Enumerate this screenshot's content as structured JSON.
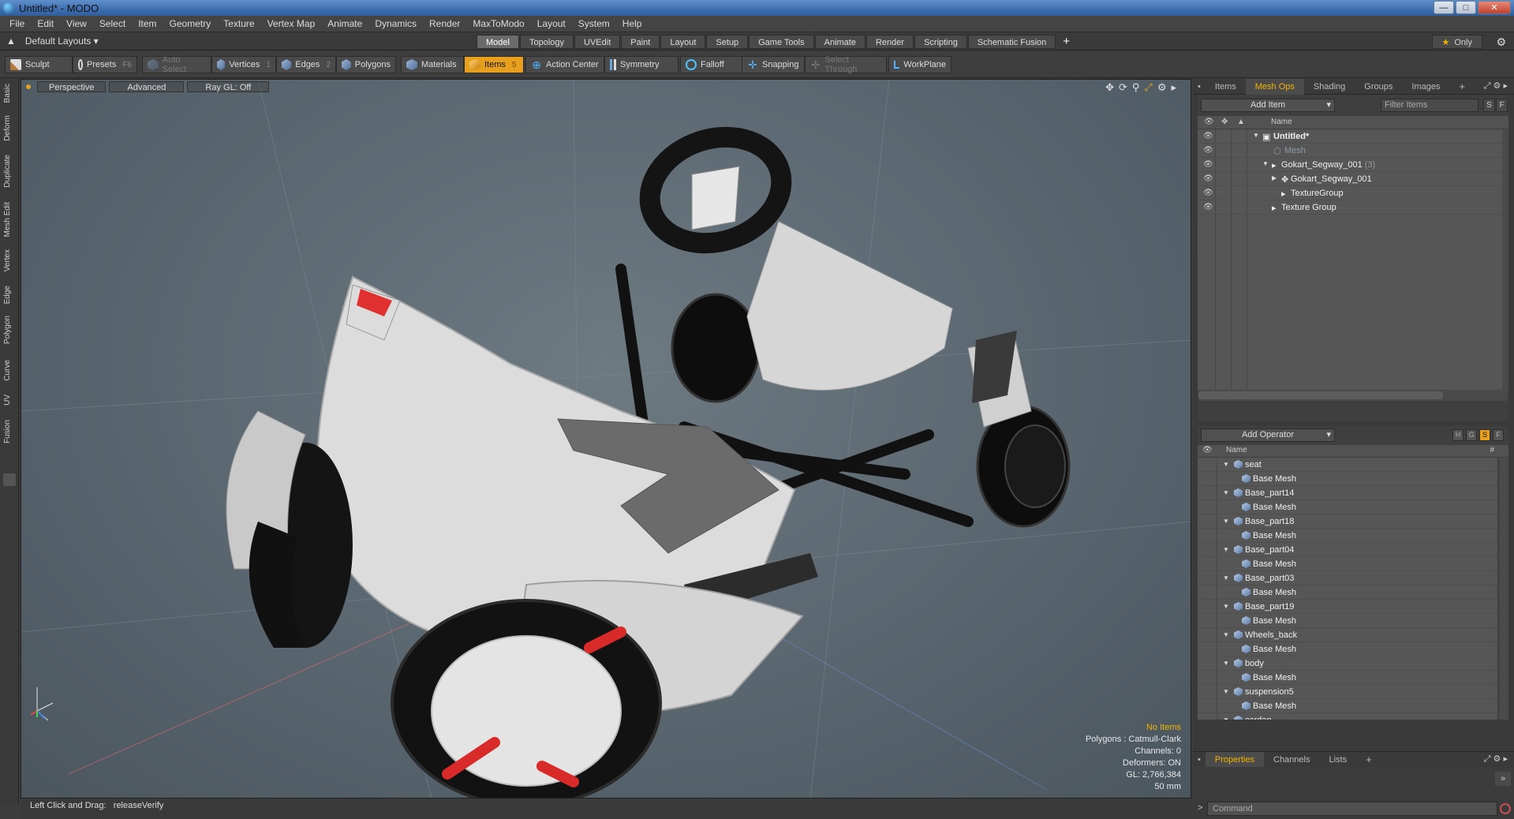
{
  "window": {
    "title": "Untitled* - MODO"
  },
  "menu": [
    "File",
    "Edit",
    "View",
    "Select",
    "Item",
    "Geometry",
    "Texture",
    "Vertex Map",
    "Animate",
    "Dynamics",
    "Render",
    "MaxToModo",
    "Layout",
    "System",
    "Help"
  ],
  "layout": {
    "selector": "Default Layouts",
    "tabs": [
      "Model",
      "Topology",
      "UVEdit",
      "Paint",
      "Layout",
      "Setup",
      "Game Tools",
      "Animate",
      "Render",
      "Scripting",
      "Schematic Fusion"
    ],
    "active_tab": "Model",
    "only_label": "Only"
  },
  "toolbar": {
    "sculpt": "Sculpt",
    "presets": "Presets",
    "presets_key": "F6",
    "auto_select": "Auto Select",
    "vertices": "Vertices",
    "vertices_key": "1",
    "edges": "Edges",
    "edges_key": "2",
    "polygons": "Polygons",
    "materials": "Materials",
    "items": "Items",
    "items_key": "5",
    "action_center": "Action Center",
    "symmetry": "Symmetry",
    "falloff": "Falloff",
    "snapping": "Snapping",
    "select_through": "Select Through",
    "workplane": "WorkPlane"
  },
  "left_tabs": [
    "Basic",
    "Deform",
    "Duplicate",
    "Mesh Edit",
    "Vertex",
    "Edge",
    "Polygon",
    "Curve",
    "UV",
    "Fusion"
  ],
  "viewport": {
    "view_mode": "Perspective",
    "shading": "Advanced",
    "raygl": "Ray GL: Off",
    "stats": {
      "no_items": "No Items",
      "polygons": "Polygons : Catmull-Clark",
      "channels": "Channels: 0",
      "deformers": "Deformers: ON",
      "gl": "GL: 2,766,384",
      "scale": "50 mm"
    }
  },
  "status": {
    "hint": "Left Click and Drag:",
    "command": "releaseVerify"
  },
  "panel_tabs": [
    "Items",
    "Mesh Ops",
    "Shading",
    "Groups",
    "Images"
  ],
  "panel_active_tab": "Mesh Ops",
  "items_list": {
    "add_item": "Add Item",
    "filter_placeholder": "Filter Items",
    "btn_s": "S",
    "btn_f": "F",
    "col_name": "Name",
    "rows": [
      {
        "label": "Untitled*",
        "depth": 0,
        "bold": true,
        "expanded": true
      },
      {
        "label": "Mesh",
        "depth": 1,
        "dim": true
      },
      {
        "label": "Gokart_Segway_001",
        "count": "(3)",
        "depth": 1,
        "expanded": true
      },
      {
        "label": "Gokart_Segway_001",
        "depth": 2,
        "collapsed": true
      },
      {
        "label": "TextureGroup",
        "depth": 2
      },
      {
        "label": "Texture Group",
        "depth": 1
      }
    ]
  },
  "mesh_ops": {
    "add_operator": "Add Operator",
    "btn_h": "H",
    "btn_g": "G",
    "btn_s": "S",
    "btn_f": "F",
    "col_name": "Name",
    "col_hash": "#",
    "rows": [
      {
        "label": "seat",
        "level": 0
      },
      {
        "label": "Base Mesh",
        "level": 1
      },
      {
        "label": "Base_part14",
        "level": 0
      },
      {
        "label": "Base Mesh",
        "level": 1
      },
      {
        "label": "Base_part18",
        "level": 0
      },
      {
        "label": "Base Mesh",
        "level": 1
      },
      {
        "label": "Base_part04",
        "level": 0
      },
      {
        "label": "Base Mesh",
        "level": 1
      },
      {
        "label": "Base_part03",
        "level": 0
      },
      {
        "label": "Base Mesh",
        "level": 1
      },
      {
        "label": "Base_part19",
        "level": 0
      },
      {
        "label": "Base Mesh",
        "level": 1
      },
      {
        "label": "Wheels_back",
        "level": 0
      },
      {
        "label": "Base Mesh",
        "level": 1
      },
      {
        "label": "body",
        "level": 0
      },
      {
        "label": "Base Mesh",
        "level": 1
      },
      {
        "label": "suspension5",
        "level": 0
      },
      {
        "label": "Base Mesh",
        "level": 1
      },
      {
        "label": "cardan",
        "level": 0
      }
    ]
  },
  "properties_tabs": [
    "Properties",
    "Channels",
    "Lists"
  ],
  "properties_active": "Properties",
  "command": {
    "placeholder": "Command"
  },
  "colors": {
    "accent": "#e6a01e",
    "viewport_bg": "#5e6a72",
    "panel_bg": "#3a3a3a"
  }
}
